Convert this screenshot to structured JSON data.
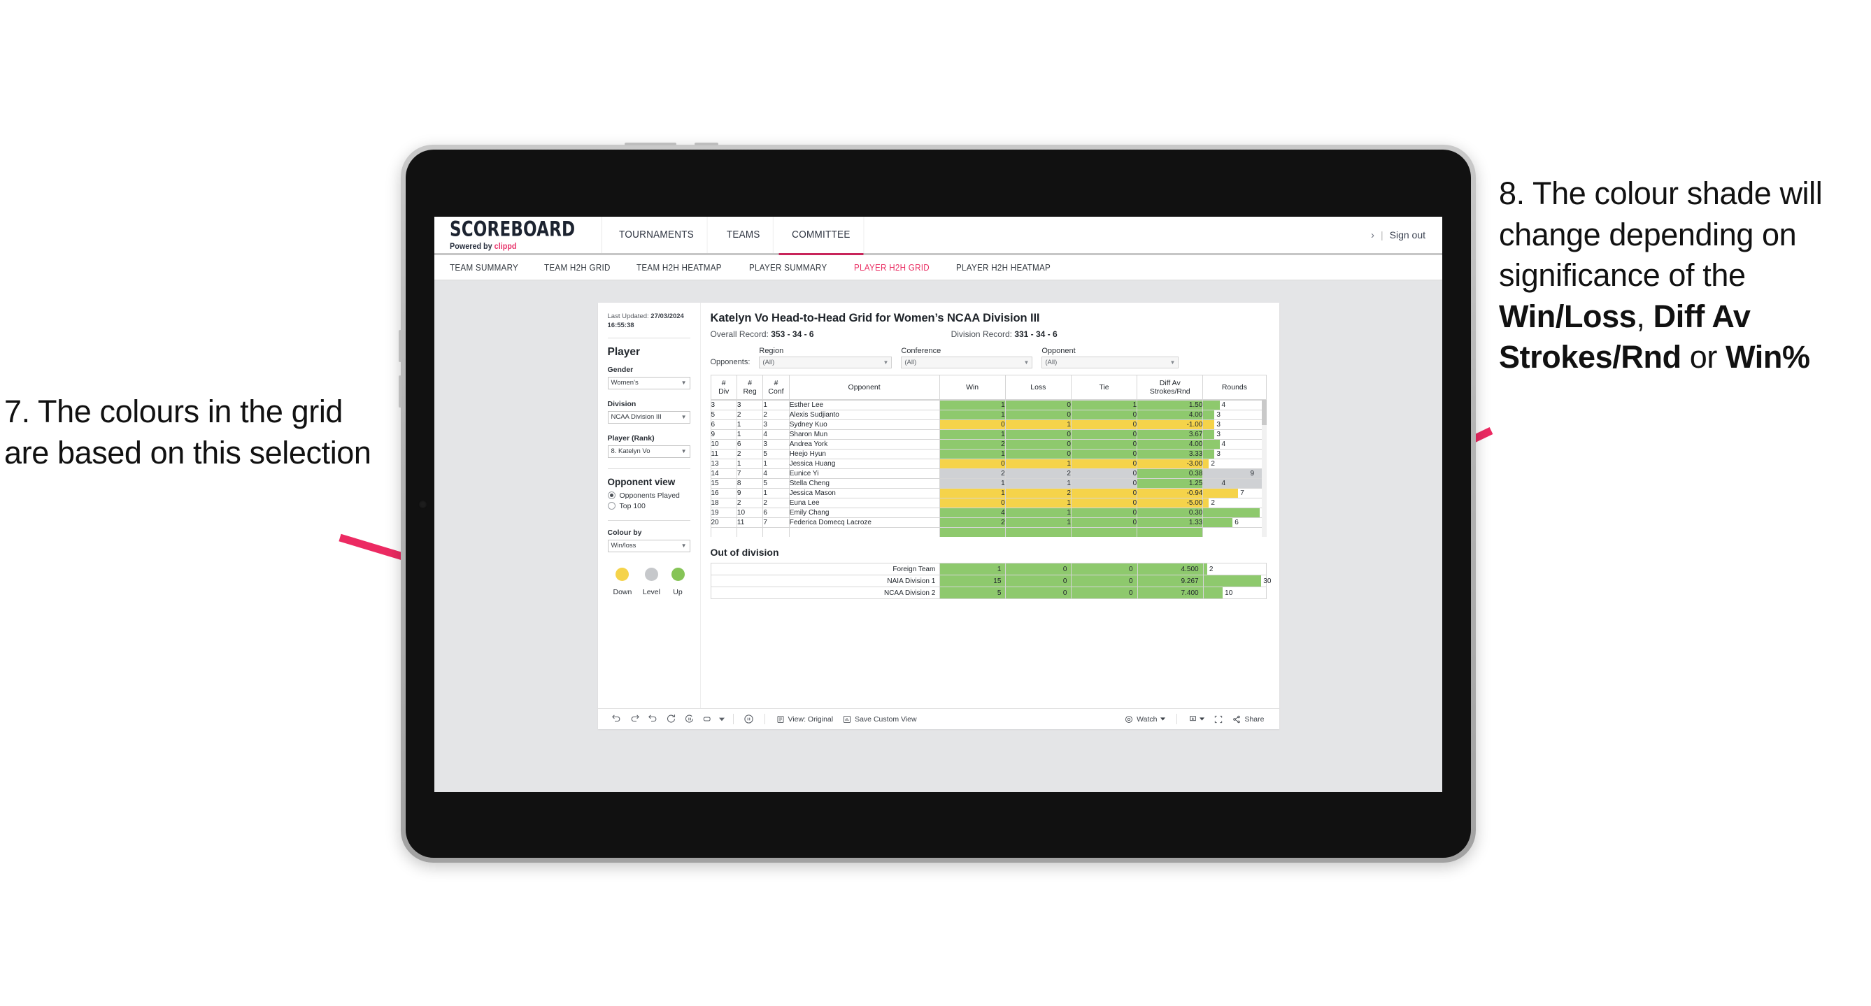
{
  "annotations": {
    "left": {
      "id": "7.",
      "text": "7. The colours in the grid are based on this selection"
    },
    "right": {
      "id": "8.",
      "part1": "8. The colour shade will change depending on significance of the ",
      "bold1": "Win/Loss",
      "mid1": ", ",
      "bold2": "Diff Av Strokes/Rnd",
      "mid2": " or ",
      "bold3": "Win%"
    },
    "arrow_color": "#ec2a62"
  },
  "header": {
    "logo_word": "SCOREBOARD",
    "logo_sub_prefix": "Powered by ",
    "logo_sub_brand": "clippd",
    "nav": [
      {
        "label": "TOURNAMENTS",
        "active": false
      },
      {
        "label": "TEAMS",
        "active": false
      },
      {
        "label": "COMMITTEE",
        "active": true
      }
    ],
    "chevron": "›",
    "separator": "|",
    "sign_out": "Sign out",
    "active_color": "#c8245a"
  },
  "subnav": {
    "items": [
      {
        "label": "TEAM SUMMARY",
        "active": false
      },
      {
        "label": "TEAM H2H GRID",
        "active": false
      },
      {
        "label": "TEAM H2H HEATMAP",
        "active": false
      },
      {
        "label": "PLAYER SUMMARY",
        "active": false
      },
      {
        "label": "PLAYER H2H GRID",
        "active": true
      },
      {
        "label": "PLAYER H2H HEATMAP",
        "active": false
      }
    ],
    "active_color": "#ea2f63"
  },
  "sidebar": {
    "last_updated_label": "Last Updated:",
    "last_updated_value": "27/03/2024 16:55:38",
    "section_player": "Player",
    "fields": [
      {
        "label": "Gender",
        "value": "Women’s"
      },
      {
        "label": "Division",
        "value": "NCAA Division III"
      },
      {
        "label": "Player (Rank)",
        "value": "8. Katelyn Vo"
      }
    ],
    "opponent_view_label": "Opponent view",
    "opponent_view_options": [
      {
        "label": "Opponents Played",
        "selected": true
      },
      {
        "label": "Top 100",
        "selected": false
      }
    ],
    "colour_by_label": "Colour by",
    "colour_by_value": "Win/loss",
    "legend": [
      {
        "label": "Down",
        "color": "#f4d košt"
      },
      {
        "label": "Level",
        "color": "#c6c8cb"
      },
      {
        "label": "Up",
        "color": "#86c457"
      }
    ],
    "legend_colors": {
      "down": "#f5d34a",
      "level": "#c6c8cb",
      "up": "#86c457"
    }
  },
  "main": {
    "title": "Katelyn Vo Head-to-Head Grid for Women’s NCAA Division III",
    "overall_record_label": "Overall Record:",
    "overall_record_value": "353 - 34 - 6",
    "division_record_label": "Division Record:",
    "division_record_value": "331 - 34 - 6",
    "opponents_label": "Opponents:",
    "filters": [
      {
        "label": "Region",
        "value": "(All)"
      },
      {
        "label": "Conference",
        "value": "(All)"
      },
      {
        "label": "Opponent",
        "value": "(All)"
      }
    ]
  },
  "chart_data": {
    "type": "table",
    "title": "Katelyn Vo Head-to-Head Grid for Women’s NCAA Division III",
    "columns": [
      {
        "l1": "#",
        "l2": "Div"
      },
      {
        "l1": "#",
        "l2": "Reg"
      },
      {
        "l1": "#",
        "l2": "Conf"
      },
      {
        "l1": "Opponent",
        "l2": ""
      },
      {
        "l1": "Win",
        "l2": ""
      },
      {
        "l1": "Loss",
        "l2": ""
      },
      {
        "l1": "Tie",
        "l2": ""
      },
      {
        "l1": "Diff Av",
        "l2": "Strokes/Rnd"
      },
      {
        "l1": "Rounds",
        "l2": ""
      }
    ],
    "rows": [
      {
        "div": "3",
        "reg": "3",
        "conf": "1",
        "opponent": "Esther Lee",
        "win": "1",
        "loss": "0",
        "tie": "1",
        "diff": "1.50",
        "rounds": "4",
        "bar_pct": 26,
        "color": "up"
      },
      {
        "div": "5",
        "reg": "2",
        "conf": "2",
        "opponent": "Alexis Sudjianto",
        "win": "1",
        "loss": "0",
        "tie": "0",
        "diff": "4.00",
        "rounds": "3",
        "bar_pct": 18,
        "color": "up"
      },
      {
        "div": "6",
        "reg": "1",
        "conf": "3",
        "opponent": "Sydney Kuo",
        "win": "0",
        "loss": "1",
        "tie": "0",
        "diff": "-1.00",
        "rounds": "3",
        "bar_pct": 18,
        "color": "down"
      },
      {
        "div": "9",
        "reg": "1",
        "conf": "4",
        "opponent": "Sharon Mun",
        "win": "1",
        "loss": "0",
        "tie": "0",
        "diff": "3.67",
        "rounds": "3",
        "bar_pct": 18,
        "color": "up"
      },
      {
        "div": "10",
        "reg": "6",
        "conf": "3",
        "opponent": "Andrea York",
        "win": "2",
        "loss": "0",
        "tie": "0",
        "diff": "4.00",
        "rounds": "4",
        "bar_pct": 26,
        "color": "up"
      },
      {
        "div": "11",
        "reg": "2",
        "conf": "5",
        "opponent": "Heejo Hyun",
        "win": "1",
        "loss": "0",
        "tie": "0",
        "diff": "3.33",
        "rounds": "3",
        "bar_pct": 18,
        "color": "up"
      },
      {
        "div": "13",
        "reg": "1",
        "conf": "1",
        "opponent": "Jessica Huang",
        "win": "0",
        "loss": "1",
        "tie": "0",
        "diff": "-3.00",
        "rounds": "2",
        "bar_pct": 9,
        "color": "down"
      },
      {
        "div": "14",
        "reg": "7",
        "conf": "4",
        "opponent": "Eunice Yi",
        "win": "2",
        "loss": "2",
        "tie": "0",
        "diff": "0.38",
        "rounds": "9",
        "bar_pct": 72,
        "color": "level",
        "diff_color": "up"
      },
      {
        "div": "15",
        "reg": "8",
        "conf": "5",
        "opponent": "Stella Cheng",
        "win": "1",
        "loss": "1",
        "tie": "0",
        "diff": "1.25",
        "rounds": "4",
        "bar_pct": 26,
        "color": "level",
        "diff_color": "up"
      },
      {
        "div": "16",
        "reg": "9",
        "conf": "1",
        "opponent": "Jessica Mason",
        "win": "1",
        "loss": "2",
        "tie": "0",
        "diff": "-0.94",
        "rounds": "7",
        "bar_pct": 56,
        "color": "down"
      },
      {
        "div": "18",
        "reg": "2",
        "conf": "2",
        "opponent": "Euna Lee",
        "win": "0",
        "loss": "1",
        "tie": "0",
        "diff": "-5.00",
        "rounds": "2",
        "bar_pct": 9,
        "color": "down"
      },
      {
        "div": "19",
        "reg": "10",
        "conf": "6",
        "opponent": "Emily Chang",
        "win": "4",
        "loss": "1",
        "tie": "0",
        "diff": "0.30",
        "rounds": "11",
        "bar_pct": 90,
        "color": "up"
      },
      {
        "div": "20",
        "reg": "11",
        "conf": "7",
        "opponent": "Federica Domecq Lacroze",
        "win": "2",
        "loss": "1",
        "tie": "0",
        "diff": "1.33",
        "rounds": "6",
        "bar_pct": 47,
        "color": "up"
      }
    ],
    "out_of_division": {
      "title": "Out of division",
      "rows": [
        {
          "name": "Foreign Team",
          "win": "1",
          "loss": "0",
          "tie": "0",
          "diff": "4.500",
          "rounds": "2",
          "bar_pct": 6,
          "color": "up"
        },
        {
          "name": "NAIA Division 1",
          "win": "15",
          "loss": "0",
          "tie": "0",
          "diff": "9.267",
          "rounds": "30",
          "bar_pct": 93,
          "color": "up"
        },
        {
          "name": "NCAA Division 2",
          "win": "5",
          "loss": "0",
          "tie": "0",
          "diff": "7.400",
          "rounds": "10",
          "bar_pct": 31,
          "color": "up"
        }
      ]
    },
    "colors": {
      "up": "#8ec96d",
      "down": "#f5d34a",
      "level": "#cfd1d4",
      "neutral": "#ffffff"
    }
  },
  "toolbar": {
    "icons": [
      "undo-icon",
      "redo-icon",
      "revert-icon",
      "refresh-icon",
      "pause-icon",
      "rectangle-select-icon"
    ],
    "view_original": "View: Original",
    "save_custom_view": "Save Custom View",
    "watch": "Watch",
    "share": "Share"
  }
}
